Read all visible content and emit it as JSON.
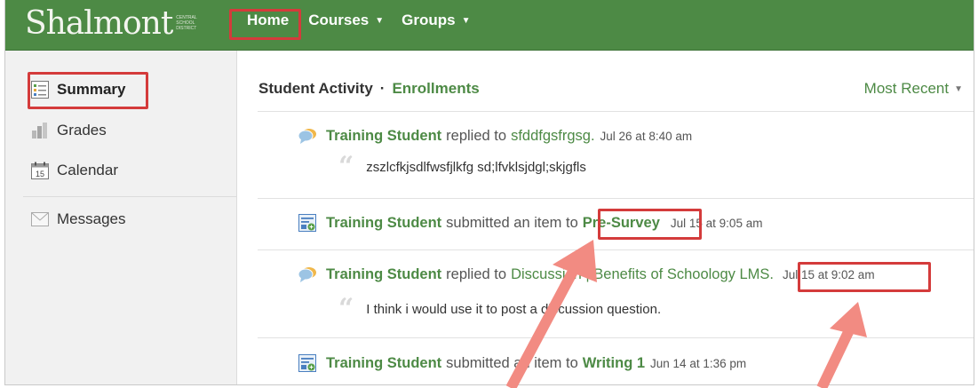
{
  "brand": {
    "name": "Shalmont",
    "sub": "CENTRAL SCHOOL DISTRICT"
  },
  "nav": {
    "home": "Home",
    "courses": "Courses",
    "groups": "Groups"
  },
  "sidebar": {
    "items": [
      {
        "label": "Summary",
        "icon": "summary-icon"
      },
      {
        "label": "Grades",
        "icon": "grades-icon"
      },
      {
        "label": "Calendar",
        "icon": "calendar-icon",
        "icon_text": "15"
      },
      {
        "label": "Messages",
        "icon": "envelope-icon"
      }
    ]
  },
  "main": {
    "title": "Student Activity",
    "separator": "·",
    "filter": "Enrollments",
    "sort": "Most Recent"
  },
  "feed": [
    {
      "icon": "comment-icon",
      "actor": "Training Student",
      "verb": "replied to",
      "target": "sfddfgsfrgsg.",
      "date": "Jul 26 at 8:40 am",
      "quote": "zszlcfkjsdlfwsfjlkfg sd;lfvklsjdgl;skjgfls"
    },
    {
      "icon": "assignment-icon",
      "actor": "Training Student",
      "verb": "submitted an item to",
      "target": "Pre-Survey",
      "date": "Jul 15 at 9:05 am"
    },
    {
      "icon": "comment-icon",
      "actor": "Training Student",
      "verb": "replied to",
      "target": "Discussion | Benefits of Schoology LMS.",
      "date": "Jul 15 at 9:02 am",
      "quote": "I think i would use it to post a discussion question."
    },
    {
      "icon": "assignment-icon",
      "actor": "Training Student",
      "verb": "submitted an item to",
      "target": "Writing 1",
      "date": "Jun 14 at 1:36 pm"
    }
  ],
  "colors": {
    "brand_green": "#4d8a45",
    "annotation_red": "#d43b3b",
    "arrow_pink": "#f28b82"
  }
}
